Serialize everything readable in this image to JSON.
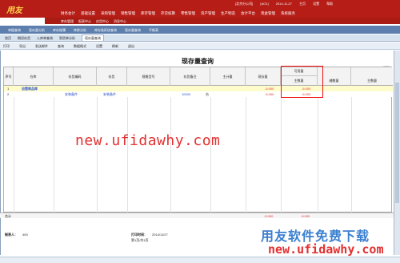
{
  "app": {
    "logo_text": "用友",
    "top_info": [
      "[北京分公司]",
      "[AO1]",
      "2014-11-27",
      "主页",
      "设置",
      "帮助"
    ]
  },
  "main_menu": [
    "财务会计",
    "基础设置",
    "采购管理",
    "销售管理",
    "库存管理",
    "存货核算",
    "零售管理",
    "资产管理",
    "生产制造",
    "会计平台",
    "现金管理",
    "系统服务"
  ],
  "sub_menu": [
    "库存管理",
    "报表中心",
    "应用中心",
    "消息中心"
  ],
  "nav_tabs": [
    "单据查询",
    "现存量分析",
    "库存账簿",
    "库龄分析",
    "库存准折核查询",
    "现存量查询",
    "平衡表"
  ],
  "page_tabs": [
    "首页",
    "期初存货",
    "入库单查询",
    "到货单分析",
    "现存量查询"
  ],
  "toolbar": [
    "打印",
    "导出",
    "发送邮件",
    "查询",
    "数据格式",
    "设置",
    "刷新",
    "退出"
  ],
  "report": {
    "title": "现存量查询",
    "print_label": "打印"
  },
  "table": {
    "headers": {
      "index": "序号",
      "warehouse": "仓库",
      "inv_code": "存货编码",
      "inv_name": "存货",
      "spec": "规格型号",
      "inv_remark": "存货备注",
      "unit": "主计量",
      "stock_qty": "现存量",
      "avail_group": "可用量",
      "avail_main": "主数量",
      "aux_qty": "辅数量",
      "aux_main": "主数量"
    },
    "rows": [
      {
        "index": "1",
        "warehouse": "自营商品库",
        "inv_code": "",
        "inv_name": "",
        "remark": "",
        "unit": "",
        "stock_qty": "-5.000",
        "avail_main": "-5.000"
      },
      {
        "index": "2",
        "warehouse": "",
        "inv_code": "安装备件",
        "inv_name": "安装备件",
        "remark": "10000",
        "unit": "台",
        "stock_qty": "-5.000",
        "avail_main": "-5.000"
      }
    ],
    "total_label": "合计",
    "total_stock": "-5.000",
    "total_avail": "-5.000"
  },
  "footer": {
    "maker_label": "制表人：",
    "maker": "400",
    "print_time_label": "打印时间：",
    "print_time": "2014/11/27",
    "page": "第1页/共1页"
  },
  "watermarks": {
    "center": "new.ufidawhy.com",
    "brand": "用友软件免费下载",
    "brand_url": "new.ufidawhy.com"
  },
  "colors": {
    "topbar": "#b51d16",
    "nav": "#5d7fad",
    "highlight_row": "#fffccb",
    "negative": "#e03030",
    "annotation_box": "#e11111",
    "brand_blue": "#3b7fd0"
  }
}
